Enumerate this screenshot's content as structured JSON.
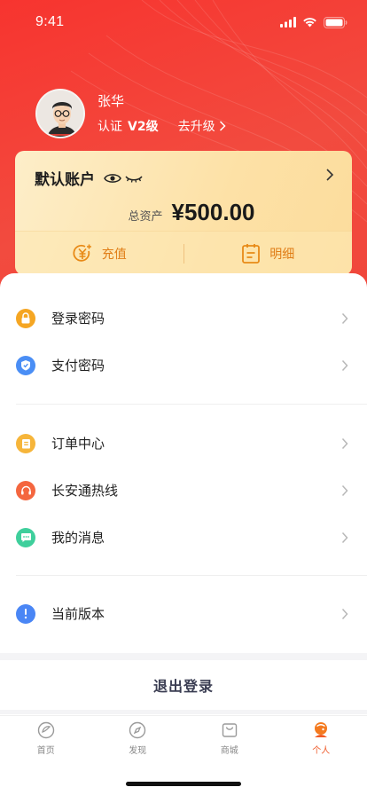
{
  "status_bar": {
    "time": "9:41"
  },
  "profile": {
    "name": "张华",
    "cert_label": "认证",
    "cert_level": "V2级",
    "upgrade_label": "去升级"
  },
  "account": {
    "title": "默认账户",
    "balance_label": "总资产",
    "balance_value": "¥500.00",
    "actions": [
      {
        "label": "充值",
        "icon": "yuan-plus-icon"
      },
      {
        "label": "明细",
        "icon": "detail-list-icon"
      }
    ]
  },
  "menu": {
    "group1": [
      {
        "label": "登录密码",
        "icon": "lock-icon",
        "color": "#f5a623"
      },
      {
        "label": "支付密码",
        "icon": "shield-icon",
        "color": "#4a8ef5"
      }
    ],
    "group2": [
      {
        "label": "订单中心",
        "icon": "order-icon",
        "color": "#f6b53a"
      },
      {
        "label": "长安通热线",
        "icon": "headset-icon",
        "color": "#f4663f"
      },
      {
        "label": "我的消息",
        "icon": "message-icon",
        "color": "#3fcf9c"
      }
    ],
    "group3": [
      {
        "label": "当前版本",
        "icon": "info-icon",
        "color": "#4a86f5"
      }
    ]
  },
  "logout_label": "退出登录",
  "tabbar": {
    "tabs": [
      {
        "label": "首页",
        "icon": "home-icon"
      },
      {
        "label": "发现",
        "icon": "compass-icon"
      },
      {
        "label": "商城",
        "icon": "shop-bag-icon"
      },
      {
        "label": "个人",
        "icon": "person-icon",
        "active": true
      }
    ]
  },
  "colors": {
    "brand_red": "#f23a31",
    "accent_orange": "#e07d16",
    "active_tab": "#ef5b2b"
  }
}
